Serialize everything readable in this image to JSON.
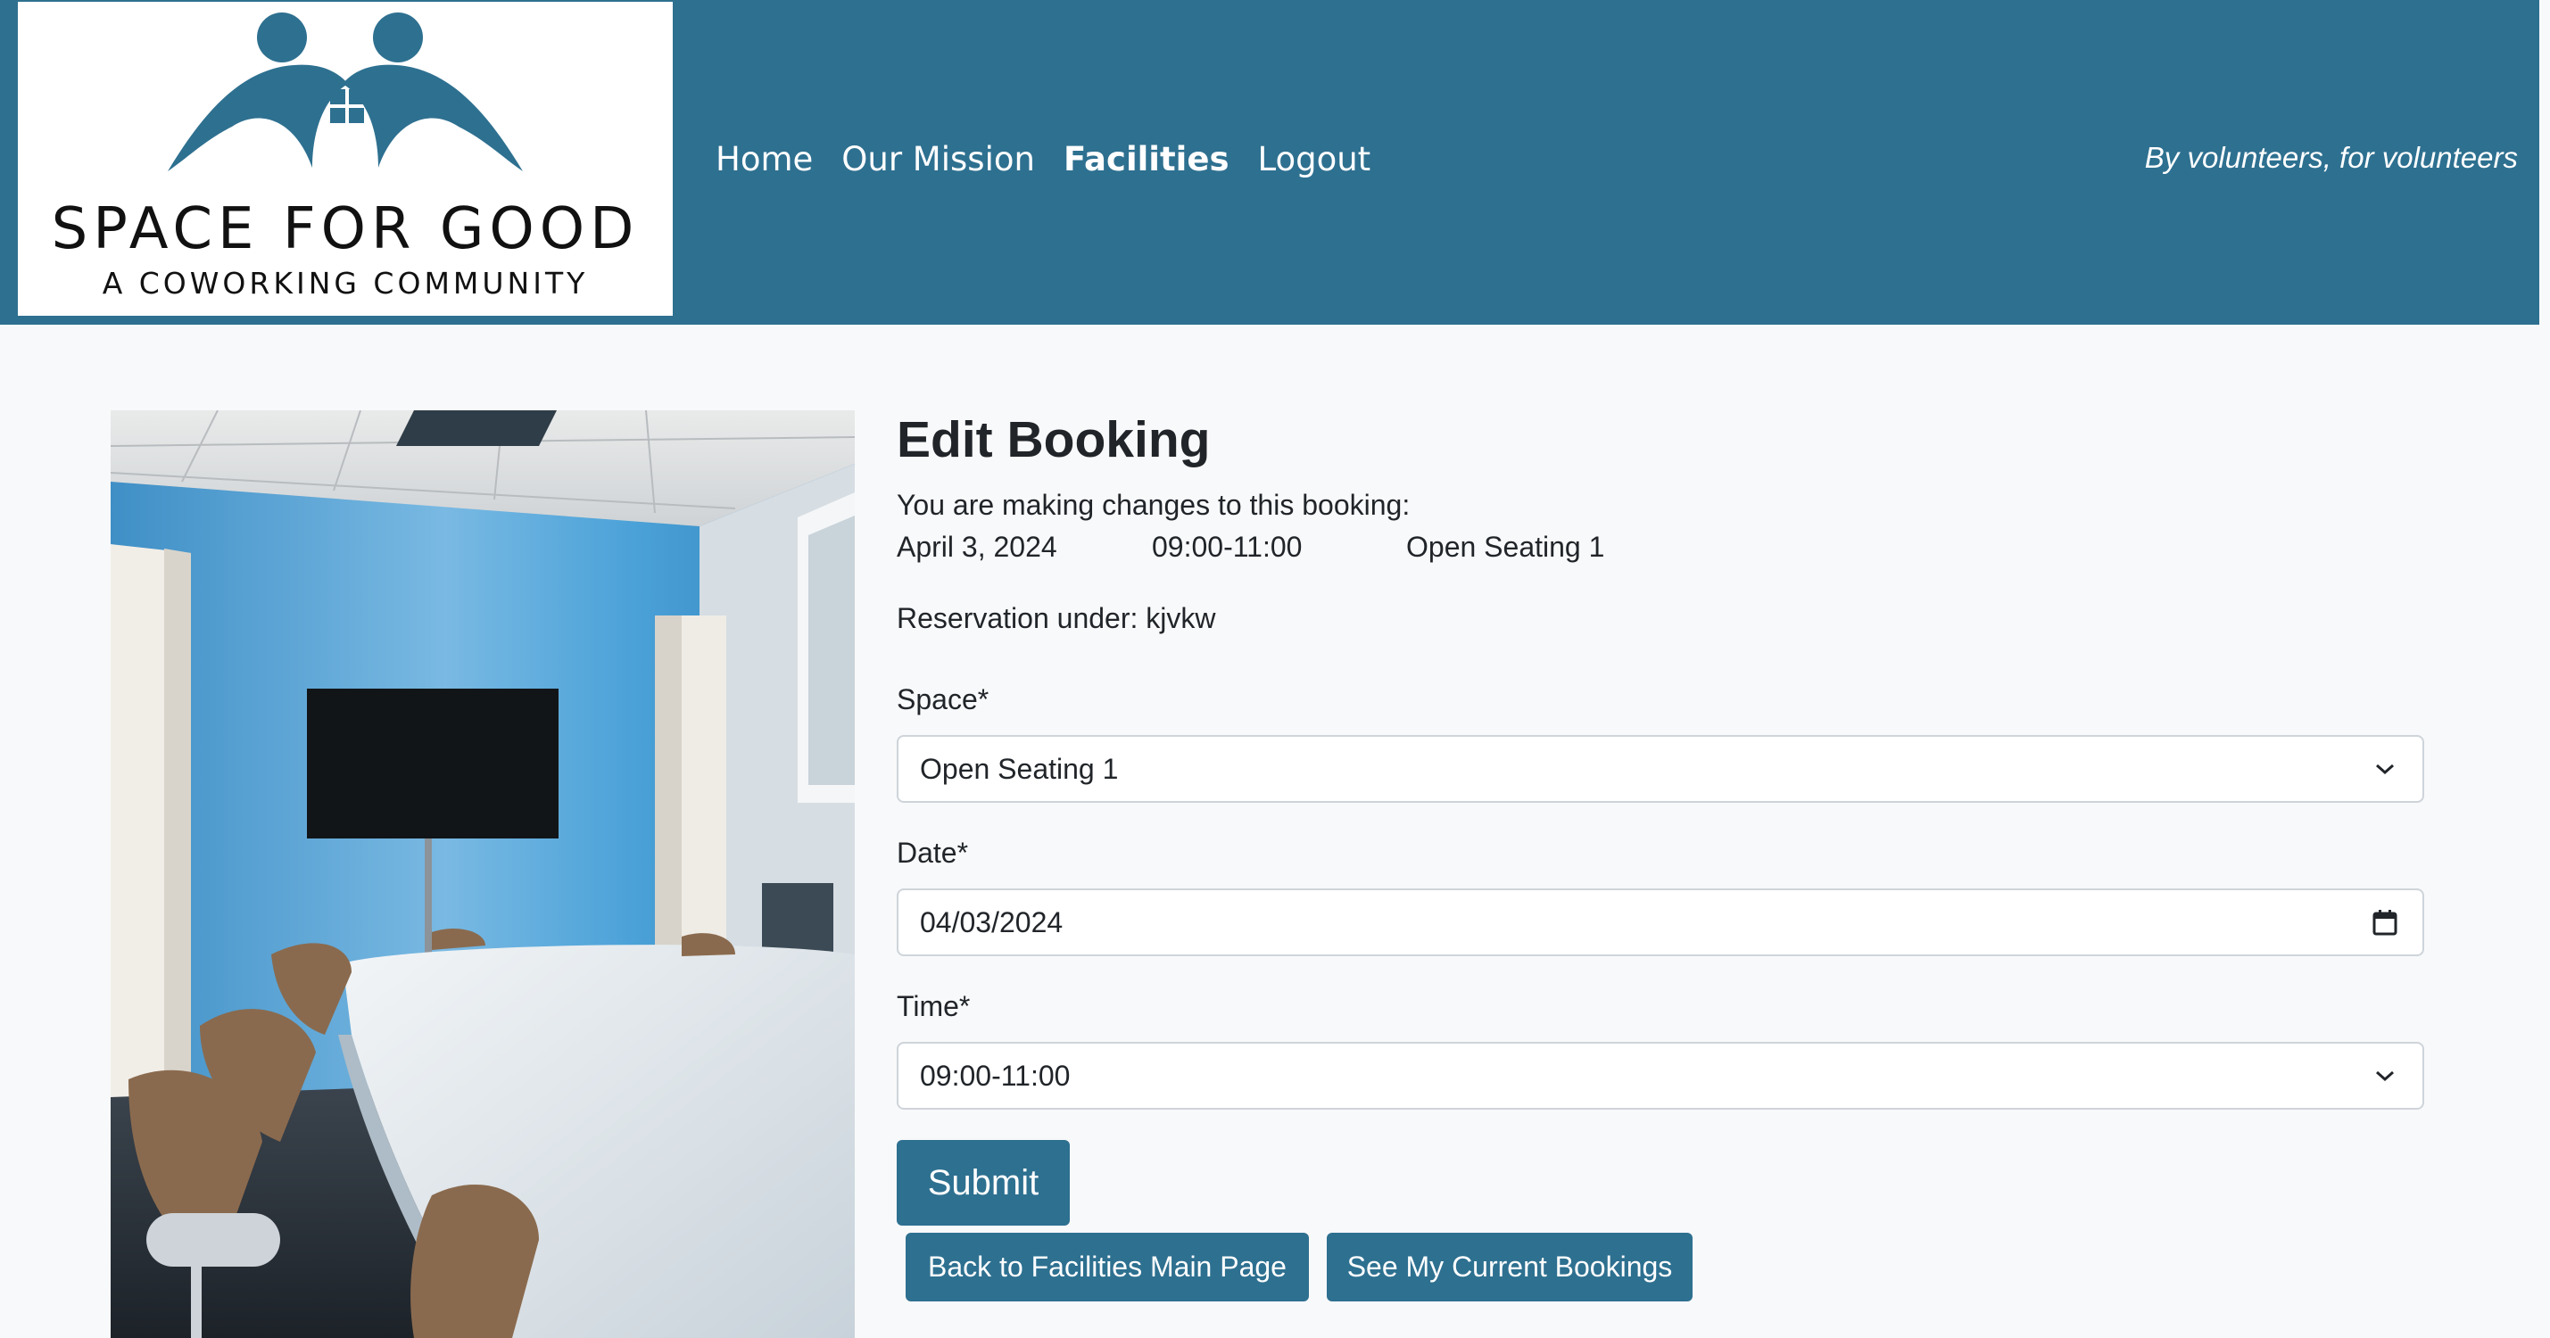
{
  "header": {
    "logo": {
      "line1": "SPACE FOR GOOD",
      "line2": "A COWORKING COMMUNITY",
      "color": "#2e7090"
    },
    "nav": [
      {
        "label": "Home",
        "active": false
      },
      {
        "label": "Our Mission",
        "active": false
      },
      {
        "label": "Facilities",
        "active": true
      },
      {
        "label": "Logout",
        "active": false
      }
    ],
    "tagline": "By volunteers, for volunteers",
    "background": "#2e7090"
  },
  "form": {
    "title": "Edit Booking",
    "intro": "You are making changes to this booking:",
    "booking": {
      "date": "April 3, 2024",
      "time": "09:00-11:00",
      "space": "Open Seating 1"
    },
    "reservation": "Reservation under: kjvkw",
    "space_label": "Space*",
    "space_value": "Open Seating 1",
    "date_label": "Date*",
    "date_value": "04/03/2024",
    "time_label": "Time*",
    "time_value": "09:00-11:00",
    "submit_label": "Submit",
    "back_label": "Back to Facilities Main Page",
    "bookings_label": "See My Current Bookings"
  },
  "icons": {
    "space_select": "chevron-down-icon",
    "date_input": "calendar-icon",
    "time_select": "chevron-down-icon"
  }
}
